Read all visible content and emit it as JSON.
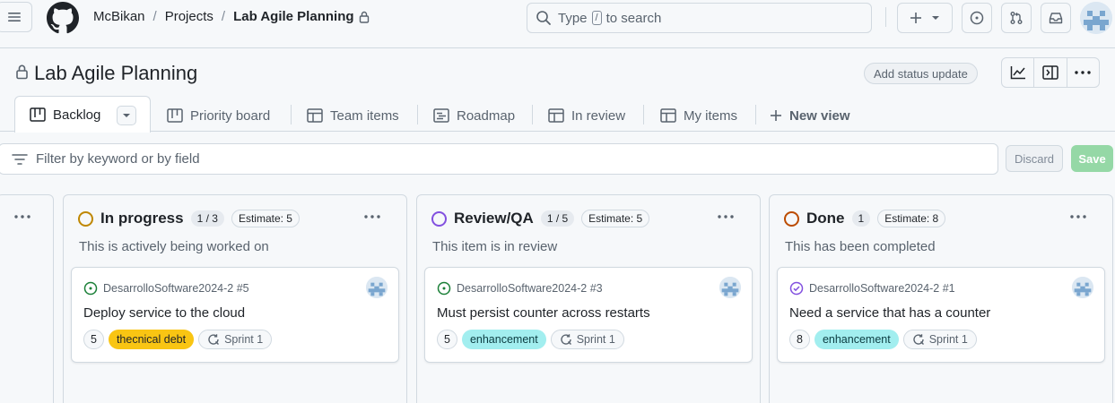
{
  "header": {
    "breadcrumb": {
      "owner": "McBikan",
      "section": "Projects",
      "project": "Lab Agile Planning",
      "separator": "/"
    },
    "search": {
      "prefix": "Type",
      "key": "/",
      "suffix": "to search"
    }
  },
  "project": {
    "title": "Lab Agile Planning",
    "status_button": "Add status update"
  },
  "tabs": [
    {
      "label": "Backlog",
      "icon": "board-icon",
      "active": true
    },
    {
      "label": "Priority board",
      "icon": "board-icon"
    },
    {
      "label": "Team items",
      "icon": "table-icon"
    },
    {
      "label": "Roadmap",
      "icon": "roadmap-icon"
    },
    {
      "label": "In review",
      "icon": "table-icon"
    },
    {
      "label": "My items",
      "icon": "table-icon"
    }
  ],
  "new_view": "New view",
  "filter": {
    "placeholder": "Filter by keyword or by field",
    "discard": "Discard",
    "save": "Save"
  },
  "columns": [
    {
      "name": "In progress",
      "count": "1 / 3",
      "estimate": "Estimate: 5",
      "description": "This is actively being worked on",
      "status_color": "#bf8700",
      "card": {
        "repo": "DesarrolloSoftware2024-2 #5",
        "title": "Deploy service to the cloud",
        "points": "5",
        "label": "thecnical debt",
        "label_bg": "#f9c513",
        "label_color": "#1f2328",
        "sprint": "Sprint 1",
        "issue_state": "open"
      }
    },
    {
      "name": "Review/QA",
      "count": "1 / 5",
      "estimate": "Estimate: 5",
      "description": "This item is in review",
      "status_color": "#8250df",
      "card": {
        "repo": "DesarrolloSoftware2024-2 #3",
        "title": "Must persist counter across restarts",
        "points": "5",
        "label": "enhancement",
        "label_bg": "#a2eeef",
        "label_color": "#0b3b40",
        "sprint": "Sprint 1",
        "issue_state": "open"
      }
    },
    {
      "name": "Done",
      "count": "1",
      "estimate": "Estimate: 8",
      "description": "This has been completed",
      "status_color": "#bc4c00",
      "card": {
        "repo": "DesarrolloSoftware2024-2 #1",
        "title": "Need a service that has a counter",
        "points": "8",
        "label": "enhancement",
        "label_bg": "#a2eeef",
        "label_color": "#0b3b40",
        "sprint": "Sprint 1",
        "issue_state": "closed"
      }
    }
  ]
}
